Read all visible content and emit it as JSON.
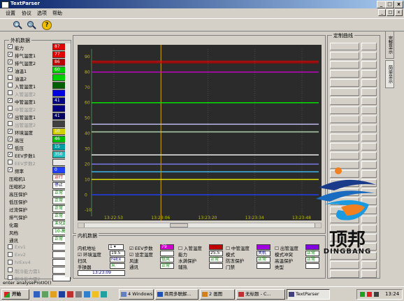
{
  "window": {
    "title": "TextParser",
    "min": "_",
    "max": "□",
    "close": "x"
  },
  "menu": [
    "设置",
    "协议",
    "选项",
    "帮助"
  ],
  "mdi_controls": [
    "_",
    "□",
    "x"
  ],
  "outer_group": {
    "title": "外机数据",
    "rows": [
      {
        "label": "能力",
        "checked": true,
        "value": "87",
        "color": "#e00000",
        "text_color": "#ffffff"
      },
      {
        "label": "排气温度1",
        "checked": true,
        "value": "77",
        "color": "#e00000",
        "text_color": "#ffffff"
      },
      {
        "label": "排气温度2",
        "checked": true,
        "value": "86",
        "color": "#c00000",
        "text_color": "#ffffff"
      },
      {
        "label": "油温1",
        "checked": true,
        "value": "60",
        "color": "#00d000",
        "text_color": "#ffffff"
      },
      {
        "label": "油温2",
        "checked": false,
        "value": "",
        "color": "#00d000",
        "text_color": "#ffffff"
      },
      {
        "label": "入管温度1",
        "checked": false,
        "value": "",
        "color": "#006000",
        "text_color": "#ffffff"
      },
      {
        "label": "入管温度2",
        "checked": false,
        "value": "",
        "color": "#0000e0",
        "text_color": "#ffffff",
        "disabled": true
      },
      {
        "label": "中管温度1",
        "checked": true,
        "value": "41",
        "color": "#000080",
        "text_color": "#ffffff"
      },
      {
        "label": "中管温度2",
        "checked": false,
        "value": "",
        "color": "#000080",
        "text_color": "#ffffff",
        "disabled": true
      },
      {
        "label": "出管温度1",
        "checked": true,
        "value": "41",
        "color": "#000060",
        "text_color": "#ffffff"
      },
      {
        "label": "出管温度2",
        "checked": false,
        "value": "",
        "color": "#404040",
        "text_color": "#ffffff",
        "disabled": true
      },
      {
        "label": "环境温度",
        "checked": true,
        "value": "10",
        "color": "#d0d000",
        "text_color": "#ffffff"
      },
      {
        "label": "高压",
        "checked": true,
        "value": "46",
        "color": "#00c000",
        "text_color": "#ffffff"
      },
      {
        "label": "低压",
        "checked": true,
        "value": "15",
        "color": "#00a0a0",
        "text_color": "#ffffff"
      },
      {
        "label": "EEV步数1",
        "checked": true,
        "value": "350",
        "color": "#20c0c0",
        "text_color": "#ffffff"
      },
      {
        "label": "EEV步数2",
        "checked": false,
        "value": "",
        "color": "#e8e8e8",
        "text_color": "#000000",
        "disabled": true
      },
      {
        "label": "频率",
        "checked": true,
        "value": "0",
        "color": "#2040ff",
        "text_color": "#ffffff"
      }
    ],
    "status_rows": [
      {
        "label": "压缩机1",
        "value": "运行",
        "cls": "r"
      },
      {
        "label": "压缩机2",
        "value": "停止",
        "cls": "b"
      },
      {
        "label": "高压保护",
        "value": "正常",
        "cls": "g"
      },
      {
        "label": "低压保护",
        "value": "正常",
        "cls": "g"
      },
      {
        "label": "过流保护",
        "value": "正常",
        "cls": "g"
      },
      {
        "label": "排气保护",
        "value": "正常",
        "cls": "g"
      },
      {
        "label": "化霜",
        "value": "未化霜",
        "cls": "g"
      },
      {
        "label": "风档",
        "value": "10-高",
        "cls": "g"
      },
      {
        "label": "通讯",
        "value": "正常",
        "cls": "g"
      }
    ],
    "disabled_rows": [
      "Exv1",
      "Exv2",
      "hrExv4",
      "制冷能力需1",
      "制冷能力需2"
    ]
  },
  "chart_data": {
    "type": "line",
    "y_ticks": [
      90,
      80,
      70,
      60,
      50,
      40,
      30,
      20,
      10,
      0,
      -10
    ],
    "ylim": [
      -14,
      95
    ],
    "x_ticks": [
      "13:22:53",
      "13:23:06",
      "13:23:20",
      "13:23:34",
      "13:23:48"
    ],
    "cursor_at": "13:23:06",
    "series": [
      {
        "value": 87,
        "color": "#e00000"
      },
      {
        "value": 86,
        "color": "#c00000"
      },
      {
        "value": 80,
        "color": "#d000d0"
      },
      {
        "value": 60,
        "color": "#00e000"
      },
      {
        "value": 46,
        "color": "#c8c8ff"
      },
      {
        "value": 41,
        "color": "#00ff00"
      },
      {
        "value": 41,
        "color": "#c0c0c0"
      },
      {
        "value": 26,
        "color": "#ffffff"
      },
      {
        "value": 20,
        "color": "#8080ff"
      },
      {
        "value": 15,
        "color": "#40c0ff"
      },
      {
        "value": 10,
        "color": "#e0e000"
      },
      {
        "value": 0,
        "color": "#2040ff"
      }
    ]
  },
  "inner_group": {
    "title": "内机数据",
    "addr_label": "内机地址",
    "addr_value": "1",
    "eev_label": "EEV步数",
    "eev_value": "79",
    "set_temp_label": "设定温度",
    "set_temp_value": "",
    "in_temp_label": "入管温度",
    "mid_temp_label": "中管温度",
    "out_temp_label": "出管温度",
    "env_temp_label": "环境温度",
    "env_temp_value": "19.5",
    "wind_label": "风速",
    "wind_value": "低风",
    "ability_label": "能力",
    "ability_value": "25.5",
    "mode_label": "模式",
    "mode_value": "关机",
    "mode_conflict_label": "模式冲突",
    "mode_conflict_value": "正常",
    "sweep_label": "扫风",
    "sweep_value": "FeEx",
    "water_label": "水满保护",
    "water_value": "正常",
    "freeze_label": "防冻保护",
    "freeze_value": "正常",
    "heat_label": "高温保护",
    "heat_value": "正常",
    "manual_label": "手操器",
    "manual_value": "从",
    "comm_label": "通讯",
    "comm_value": "正常",
    "aux_label": "辅热",
    "door_label": "门禁",
    "type_label": "类型",
    "time_value": "13:23:09"
  },
  "right_panel": {
    "title": "定制曲线",
    "tabs": [
      "完整显示",
      "简单显示"
    ]
  },
  "logo": {
    "cn": "顶邦",
    "en": "DINGBANG"
  },
  "statusbar": {
    "text": "enter analyseProtIO()"
  },
  "taskbar": {
    "start": "开始",
    "buttons": [
      "4 Windows ...",
      "商用多联解...",
      "2 画图",
      "无标题 - C...",
      "TextParser"
    ],
    "clock": "13:24"
  }
}
